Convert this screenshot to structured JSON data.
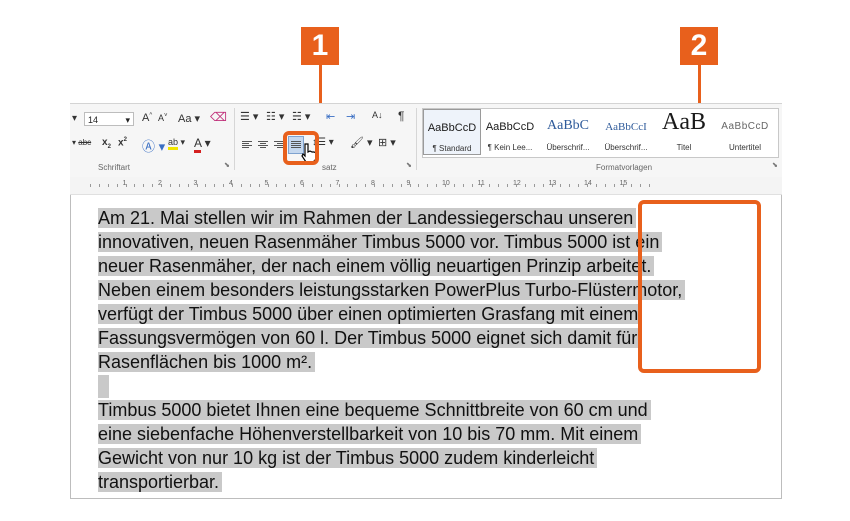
{
  "callouts": {
    "one": "1",
    "two": "2"
  },
  "ribbon": {
    "font_size": "14",
    "font_grow": "A",
    "font_shrink": "A",
    "change_case": "Aa",
    "strike": "abc",
    "subscript": "x",
    "superscript": "x",
    "pilcrow": "¶",
    "sort": "A↓",
    "group_font": "Schriftart",
    "group_paragraph_fragment": "satz",
    "group_styles": "Formatvorlagen",
    "styles": [
      {
        "sample": "AaBbCcD",
        "name": "¶ Standard"
      },
      {
        "sample": "AaBbCcD",
        "name": "¶ Kein Lee..."
      },
      {
        "sample": "AaBbC",
        "name": "Überschrif..."
      },
      {
        "sample": "AaBbCcI",
        "name": "Überschrif..."
      },
      {
        "sample": "AaB",
        "name": "Titel"
      },
      {
        "sample": "AaBbCcD",
        "name": "Untertitel"
      }
    ]
  },
  "ruler": {
    "numbers": [
      "1",
      "2",
      "3",
      "4",
      "5",
      "6",
      "7",
      "8",
      "9",
      "10",
      "11",
      "12",
      "13",
      "14",
      "15"
    ]
  },
  "document": {
    "lines": [
      "Am 21. Mai stellen wir im Rahmen der Landessiegerschau unseren",
      "innovativen, neuen Rasenmäher Timbus 5000 vor. Timbus 5000 ist ein",
      "neuer Rasenmäher, der nach einem völlig neuartigen Prinzip arbeitet.",
      "Neben einem besonders leistungsstarken PowerPlus Turbo-Flüstermotor,",
      "verfügt der Timbus 5000 über einen optimierten Grasfang mit einem",
      "Fassungsvermögen von 60 l. Der Timbus 5000 eignet sich damit für",
      "Rasenflächen bis 1000 m².",
      "",
      "Timbus 5000 bietet Ihnen eine bequeme Schnittbreite von 60 cm und",
      "eine siebenfache Höhenverstellbarkeit von 10 bis 70 mm. Mit einem",
      "Gewicht von nur 10 kg ist der Timbus 5000 zudem kinderleicht",
      "transportierbar."
    ]
  },
  "colors": {
    "accent": "#e8601c",
    "selection": "#c9c9c9"
  }
}
